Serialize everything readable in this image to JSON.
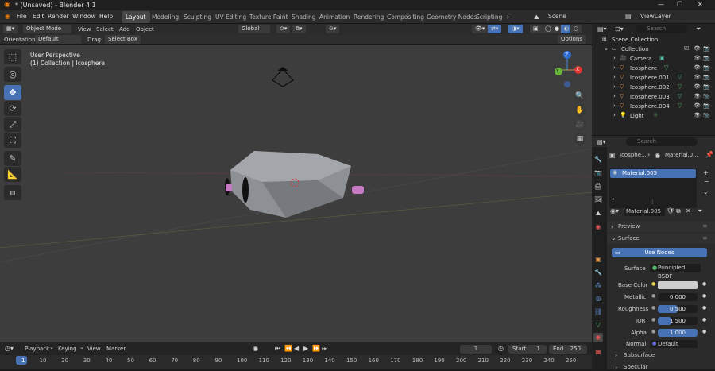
{
  "window": {
    "title": "* (Unsaved) - Blender 4.1",
    "controls": [
      "—",
      "❐",
      "✕"
    ]
  },
  "menu": [
    "File",
    "Edit",
    "Render",
    "Window",
    "Help"
  ],
  "workspaces": [
    "Layout",
    "Modeling",
    "Sculpting",
    "UV Editing",
    "Texture Paint",
    "Shading",
    "Animation",
    "Rendering",
    "Compositing",
    "Geometry Nodes",
    "Scripting"
  ],
  "add_workspace": "+",
  "scene": "Scene",
  "viewlayer": "ViewLayer",
  "header": {
    "mode": "Object Mode",
    "view": "View",
    "select": "Select",
    "add": "Add",
    "object": "Object",
    "transform": "Global",
    "options": "Options"
  },
  "header3": {
    "orientation_label": "Orientation:",
    "orientation": "Default",
    "drag_label": "Drag:",
    "drag": "Select Box"
  },
  "viewport": {
    "title": "User Perspective",
    "subtitle": "(1) Collection | Icosphere",
    "axes": {
      "z": "Z",
      "y": "Y",
      "x": "X"
    }
  },
  "outliner": {
    "search_placeholder": "Search",
    "rows": [
      {
        "label": "Scene Collection",
        "indent": 0,
        "icon": "scene",
        "color": "#cfcfcf"
      },
      {
        "label": "Collection",
        "indent": 1,
        "icon": "collection",
        "color": "#cfcfcf"
      },
      {
        "label": "Camera",
        "indent": 2,
        "icon": "camera",
        "color": "#e39b4a"
      },
      {
        "label": "Icosphere",
        "indent": 2,
        "icon": "mesh",
        "color": "#e39b4a"
      },
      {
        "label": "Icosphere.001",
        "indent": 2,
        "icon": "mesh",
        "color": "#e39b4a"
      },
      {
        "label": "Icosphere.002",
        "indent": 2,
        "icon": "mesh",
        "color": "#e39b4a"
      },
      {
        "label": "Icosphere.003",
        "indent": 2,
        "icon": "mesh",
        "color": "#e39b4a"
      },
      {
        "label": "Icosphere.004",
        "indent": 2,
        "icon": "mesh",
        "color": "#e39b4a"
      },
      {
        "label": "Light",
        "indent": 2,
        "icon": "light",
        "color": "#e39b4a"
      }
    ]
  },
  "properties": {
    "search_placeholder": "Search",
    "breadcrumb_obj": "Icosphe...",
    "breadcrumb_mat": "Material.0...",
    "slot": "Material.005",
    "material": "Material.005",
    "preview": "Preview",
    "surface_panel": "Surface",
    "use_nodes": "Use Nodes",
    "surface_label": "Surface",
    "surface_value": "Principled BSDF",
    "fields": [
      {
        "label": "Base Color",
        "value": "",
        "fill": 0
      },
      {
        "label": "Metallic",
        "value": "0.000",
        "fill": 0
      },
      {
        "label": "Roughness",
        "value": "0.500",
        "fill": 0.5
      },
      {
        "label": "IOR",
        "value": "1.500",
        "fill": 0.333
      },
      {
        "label": "Alpha",
        "value": "1.000",
        "fill": 1
      }
    ],
    "normal_label": "Normal",
    "normal_value": "Default",
    "subsurface": "Subsurface",
    "specular": "Specular"
  },
  "timeline": {
    "playback": "Playback",
    "keying": "Keying",
    "view": "View",
    "marker": "Marker",
    "current": "1",
    "start_label": "Start",
    "start": "1",
    "end_label": "End",
    "end": "250",
    "ticks": [
      "1",
      "10",
      "20",
      "30",
      "40",
      "50",
      "60",
      "70",
      "80",
      "90",
      "100",
      "110",
      "120",
      "130",
      "140",
      "150",
      "160",
      "170",
      "180",
      "190",
      "200",
      "210",
      "220",
      "230",
      "240",
      "250"
    ]
  },
  "colors": {
    "accent": "#4772b3",
    "active_tab": "#474747",
    "viewport": "#3d3d3d"
  }
}
